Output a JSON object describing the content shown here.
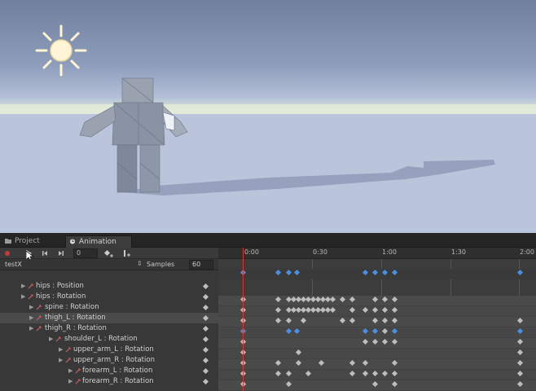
{
  "tabs": [
    {
      "label": "Project",
      "active": false,
      "icon": "folder-icon"
    },
    {
      "label": "Animation",
      "active": true,
      "icon": "clock-icon"
    }
  ],
  "toolbar": {
    "record": "record-icon",
    "play": "play-icon",
    "prev_key": "prev-keyframe-icon",
    "next_key": "next-keyframe-icon",
    "frame": "0",
    "add_key": "add-keyframe-icon",
    "add_event": "add-event-icon"
  },
  "clip": {
    "name": "testX",
    "samples_label": "Samples",
    "samples": "60"
  },
  "timeline": {
    "ticks": [
      "0:00",
      "0:30",
      "1:00",
      "1:30",
      "2:00"
    ]
  },
  "properties": [
    {
      "label": "hips : Position",
      "selected": false
    },
    {
      "label": "hips : Rotation",
      "selected": false
    },
    {
      "label": "spine : Rotation",
      "selected": false
    },
    {
      "label": "thigh_L : Rotation",
      "selected": true
    },
    {
      "label": "thigh_R : Rotation",
      "selected": false
    },
    {
      "label": "shoulder_L : Rotation",
      "selected": false
    },
    {
      "label": "upper_arm_L : Rotation",
      "selected": false
    },
    {
      "label": "upper_arm_R : Rotation",
      "selected": false
    },
    {
      "label": "forearm_L : Rotation",
      "selected": false
    },
    {
      "label": "forearm_R : Rotation",
      "selected": false
    }
  ],
  "colors": {
    "keyframe": "#bdbdbd",
    "selected_keyframe": "#4a8fe0",
    "scrubber": "#e03030",
    "record": "#c43b3b"
  }
}
